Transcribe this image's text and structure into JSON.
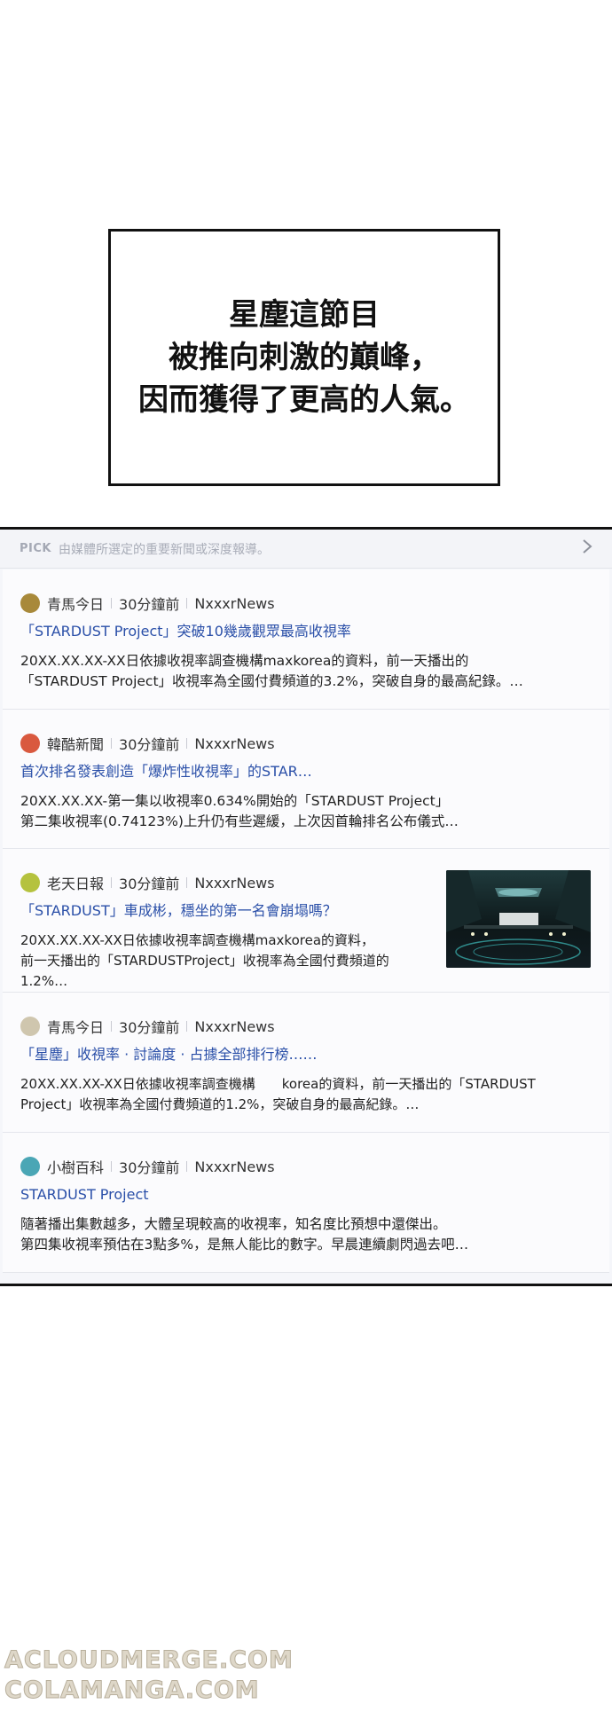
{
  "caption": {
    "line1": "星塵這節目",
    "line2": "被推向刺激的巔峰，",
    "line3": "因而獲得了更高的人氣。"
  },
  "pick_header": {
    "logo": "PICK",
    "description": "由媒體所選定的重要新聞或深度報導。",
    "chevron_icon": "chevron-right-icon"
  },
  "news": [
    {
      "source": "青馬今日",
      "time": "30分鐘前",
      "outlet": "NxxxrNews",
      "avatar_color": "#a8893a",
      "headline": "「STARDUST Project」突破10幾歲觀眾最高收視率",
      "snippet1": "20XX.XX.XX-XX日依據收視率調查機構maxkorea的資料，前一天播出的",
      "snippet2": "「STARDUST Project」收視率為全國付費頻道的3.2%，突破自身的最高紀錄。…"
    },
    {
      "source": "韓酷新聞",
      "time": "30分鐘前",
      "outlet": "NxxxrNews",
      "avatar_color": "#d9593f",
      "headline": "首次排名發表創造「爆炸性收視率」的STAR…",
      "snippet1": "20XX.XX.XX-第一集以收視率0.634%開始的「STARDUST Project」",
      "snippet2": "第二集收視率(0.74123%)上升仍有些遲緩，上次因首輪排名公布儀式…"
    },
    {
      "source": "老天日報",
      "time": "30分鐘前",
      "outlet": "NxxxrNews",
      "avatar_color": "#b5c23e",
      "headline": "「STARDUST」車成彬，穩坐的第一名會崩塌嗎？",
      "snippet1": "20XX.XX.XX-XX日依據收視率調查機構maxkorea的資料，",
      "snippet2": "前一天播出的「STARDUSTProject」收視率為全國付費頻道的",
      "snippet3": "1.2%…"
    },
    {
      "source": "青馬今日",
      "time": "30分鐘前",
      "outlet": "NxxxrNews",
      "avatar_color": "#cfc6ae",
      "headline": "「星塵」收視率 · 討論度 · 占據全部排行榜……",
      "snippet1": "20XX.XX.XX-XX日依據收視率調查機構　　korea的資料，前一天播出的「STARDUST",
      "snippet2": "Project」收視率為全國付費頻道的1.2%，突破自身的最高紀錄。…"
    },
    {
      "source": "小樹百科",
      "time": "30分鐘前",
      "outlet": "NxxxrNews",
      "avatar_color": "#4aa6b5",
      "headline": "STARDUST Project",
      "snippet1": "隨著播出集數越多，大體呈現較高的收視率，知名度比預想中還傑出。",
      "snippet2": "第四集收視率預估在3點多%，是無人能比的數字。早晨連續劇閃過去吧…"
    }
  ],
  "watermark": {
    "line1": "ACLOUDMERGE.COM",
    "line2": "COLAMANGA.COM"
  }
}
